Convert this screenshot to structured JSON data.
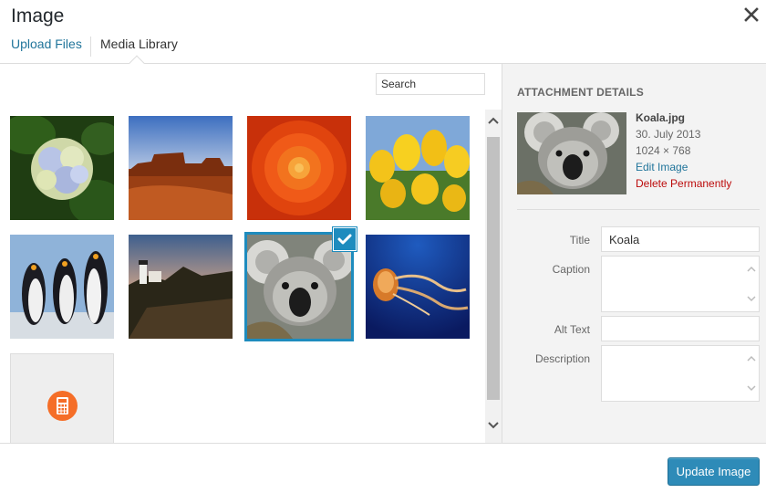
{
  "modal": {
    "title": "Image",
    "close_icon": "close-icon"
  },
  "tabs": [
    {
      "label": "Upload Files",
      "active": false
    },
    {
      "label": "Media Library",
      "active": true
    }
  ],
  "browser": {
    "search_placeholder": "Search",
    "items": [
      {
        "name": "hydrangeas",
        "selected": false
      },
      {
        "name": "desert",
        "selected": false
      },
      {
        "name": "chrysanthemum",
        "selected": false
      },
      {
        "name": "tulips",
        "selected": false
      },
      {
        "name": "penguins",
        "selected": false
      },
      {
        "name": "lighthouse",
        "selected": false
      },
      {
        "name": "koala",
        "selected": true
      },
      {
        "name": "jellyfish",
        "selected": false
      },
      {
        "name": "document",
        "selected": false,
        "icon": "spreadsheet-icon"
      }
    ]
  },
  "details": {
    "heading": "ATTACHMENT DETAILS",
    "filename": "Koala.jpg",
    "date": "30. July 2013",
    "dimensions": "1024 × 768",
    "edit_link": "Edit Image",
    "delete_link": "Delete Permanently"
  },
  "form": {
    "title_label": "Title",
    "title_value": "Koala",
    "caption_label": "Caption",
    "caption_value": "",
    "alt_label": "Alt Text",
    "alt_value": "",
    "description_label": "Description",
    "description_value": ""
  },
  "footer": {
    "primary_button": "Update Image"
  },
  "colors": {
    "accent": "#1e8cbe",
    "link": "#21759b",
    "delete": "#bc0b0b",
    "button": "#2e8bb8"
  }
}
